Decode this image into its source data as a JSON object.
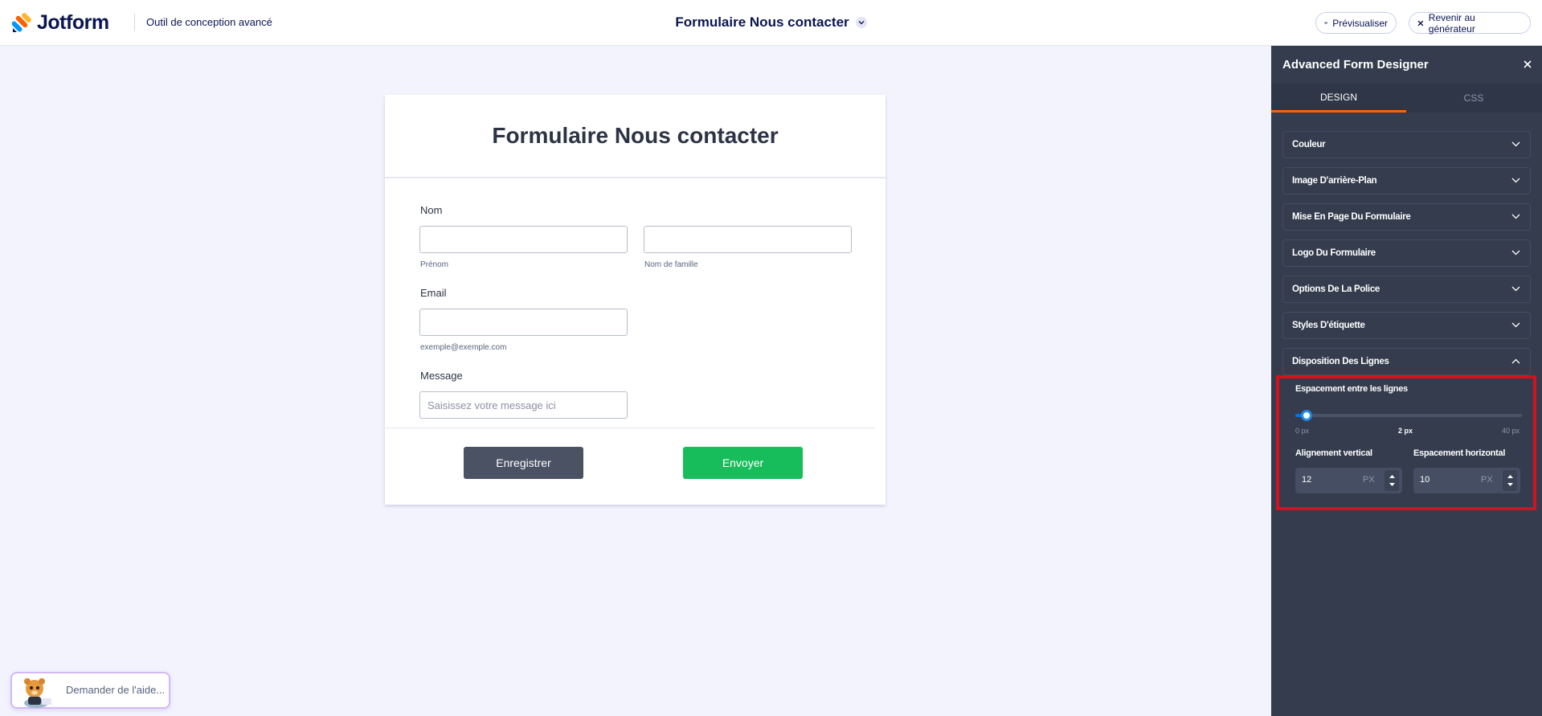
{
  "topbar": {
    "brand": "Jotform",
    "subtitle": "Outil de conception avancé",
    "form_title": "Formulaire Nous contacter",
    "preview_label": "Prévisualiser",
    "back_label": "Revenir au générateur"
  },
  "form": {
    "title": "Formulaire Nous contacter",
    "fields": {
      "name_label": "Nom",
      "first_name_sublabel": "Prénom",
      "last_name_sublabel": "Nom de famille",
      "email_label": "Email",
      "email_sublabel": "exemple@exemple.com",
      "message_label": "Message",
      "message_placeholder": "Saisissez votre message ici"
    },
    "save_button": "Enregistrer",
    "submit_button": "Envoyer"
  },
  "help": {
    "label": "Demander de l'aide..."
  },
  "panel": {
    "title": "Advanced Form Designer",
    "tabs": [
      {
        "label": "DESIGN",
        "active": true
      },
      {
        "label": "CSS",
        "active": false
      }
    ],
    "sections": [
      {
        "label": "Couleur",
        "expanded": false
      },
      {
        "label": "Image D'arrière-Plan",
        "expanded": false
      },
      {
        "label": "Mise En Page Du Formulaire",
        "expanded": false
      },
      {
        "label": "Logo Du Formulaire",
        "expanded": false
      },
      {
        "label": "Options De La Police",
        "expanded": false
      },
      {
        "label": "Styles D'étiquette",
        "expanded": false
      },
      {
        "label": "Disposition Des Lignes",
        "expanded": true
      }
    ],
    "line_layout": {
      "spacing_label": "Espacement entre les lignes",
      "slider": {
        "min": 0,
        "max": 40,
        "value": 2
      },
      "min_label": "0 px",
      "value_label": "2 px",
      "max_label": "40 px",
      "vertical_align_label": "Alignement vertical",
      "vertical_align_value": "12",
      "horizontal_spacing_label": "Espacement horizontal",
      "horizontal_spacing_value": "10",
      "unit": "PX"
    }
  },
  "colors": {
    "accent_orange": "#ff6100",
    "brand_navy": "#0a1551",
    "submit_green": "#18bd5b",
    "save_gray": "#4b5264",
    "panel_bg": "#343c4d",
    "highlight_red": "#d7101e",
    "slider_blue": "#0075e3"
  }
}
